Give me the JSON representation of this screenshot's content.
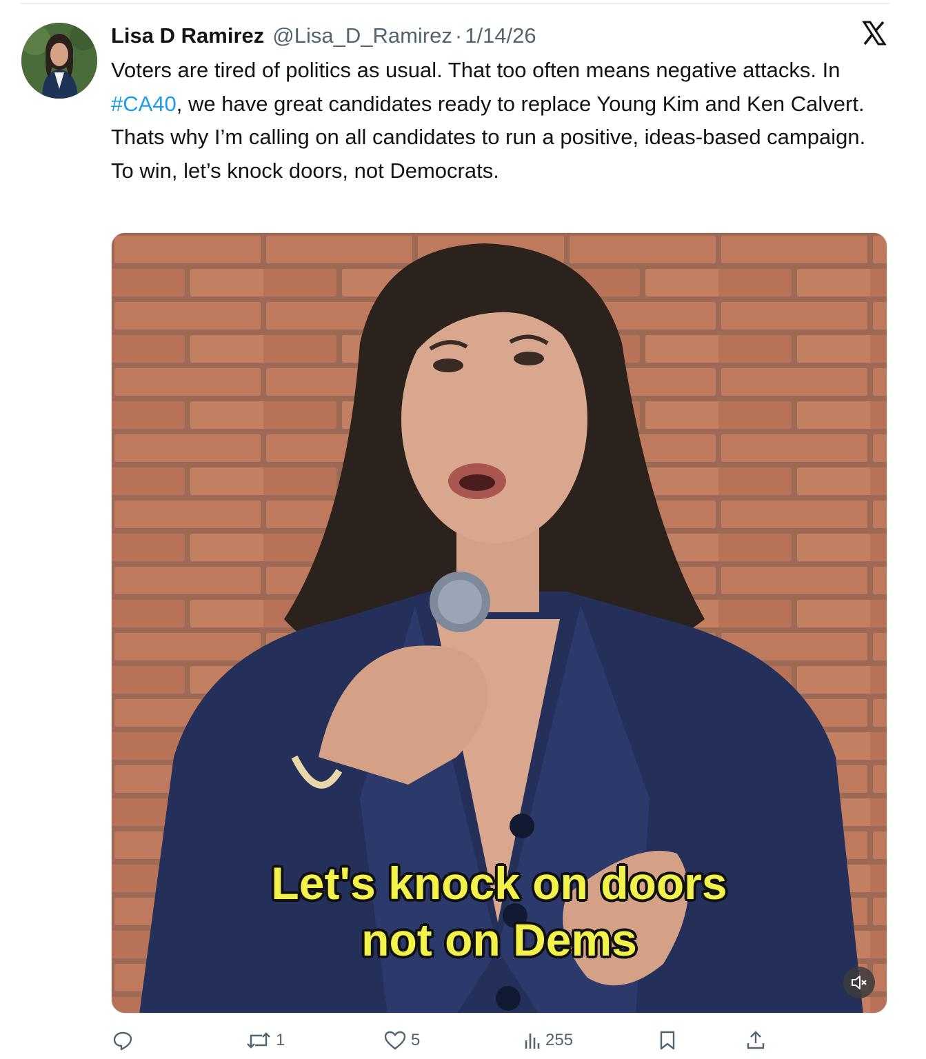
{
  "tweet": {
    "author_name": "Lisa D Ramirez",
    "author_handle": "@Lisa_D_Ramirez",
    "separator": "·",
    "date": "1/14/26",
    "text_before_hashtag": "Voters are tired of politics as usual. That too often means negative attacks. In ",
    "hashtag": "#CA40",
    "text_after_hashtag": ", we have great candidates ready to replace Young Kim and Ken Calvert. Thats why I’m calling on all candidates to run a positive, ideas-based campaign. To win, let’s knock doors, not Democrats."
  },
  "media": {
    "caption_line1": "Let's knock on doors",
    "caption_line2": "not on Dems",
    "mute_icon": "speaker-muted-icon"
  },
  "actions": {
    "reply_icon": "reply-icon",
    "reply_count": "",
    "retweet_icon": "retweet-icon",
    "retweet_count": "1",
    "like_icon": "heart-icon",
    "like_count": "5",
    "views_icon": "views-bar-chart-icon",
    "views_count": "255",
    "bookmark_icon": "bookmark-icon",
    "share_icon": "share-upload-icon"
  },
  "brand": {
    "logo_icon": "x-logo-icon",
    "link_color": "#1d9bf0",
    "text_color": "#0f1419",
    "muted_color": "#536471",
    "caption_color": "#f2f24a"
  }
}
